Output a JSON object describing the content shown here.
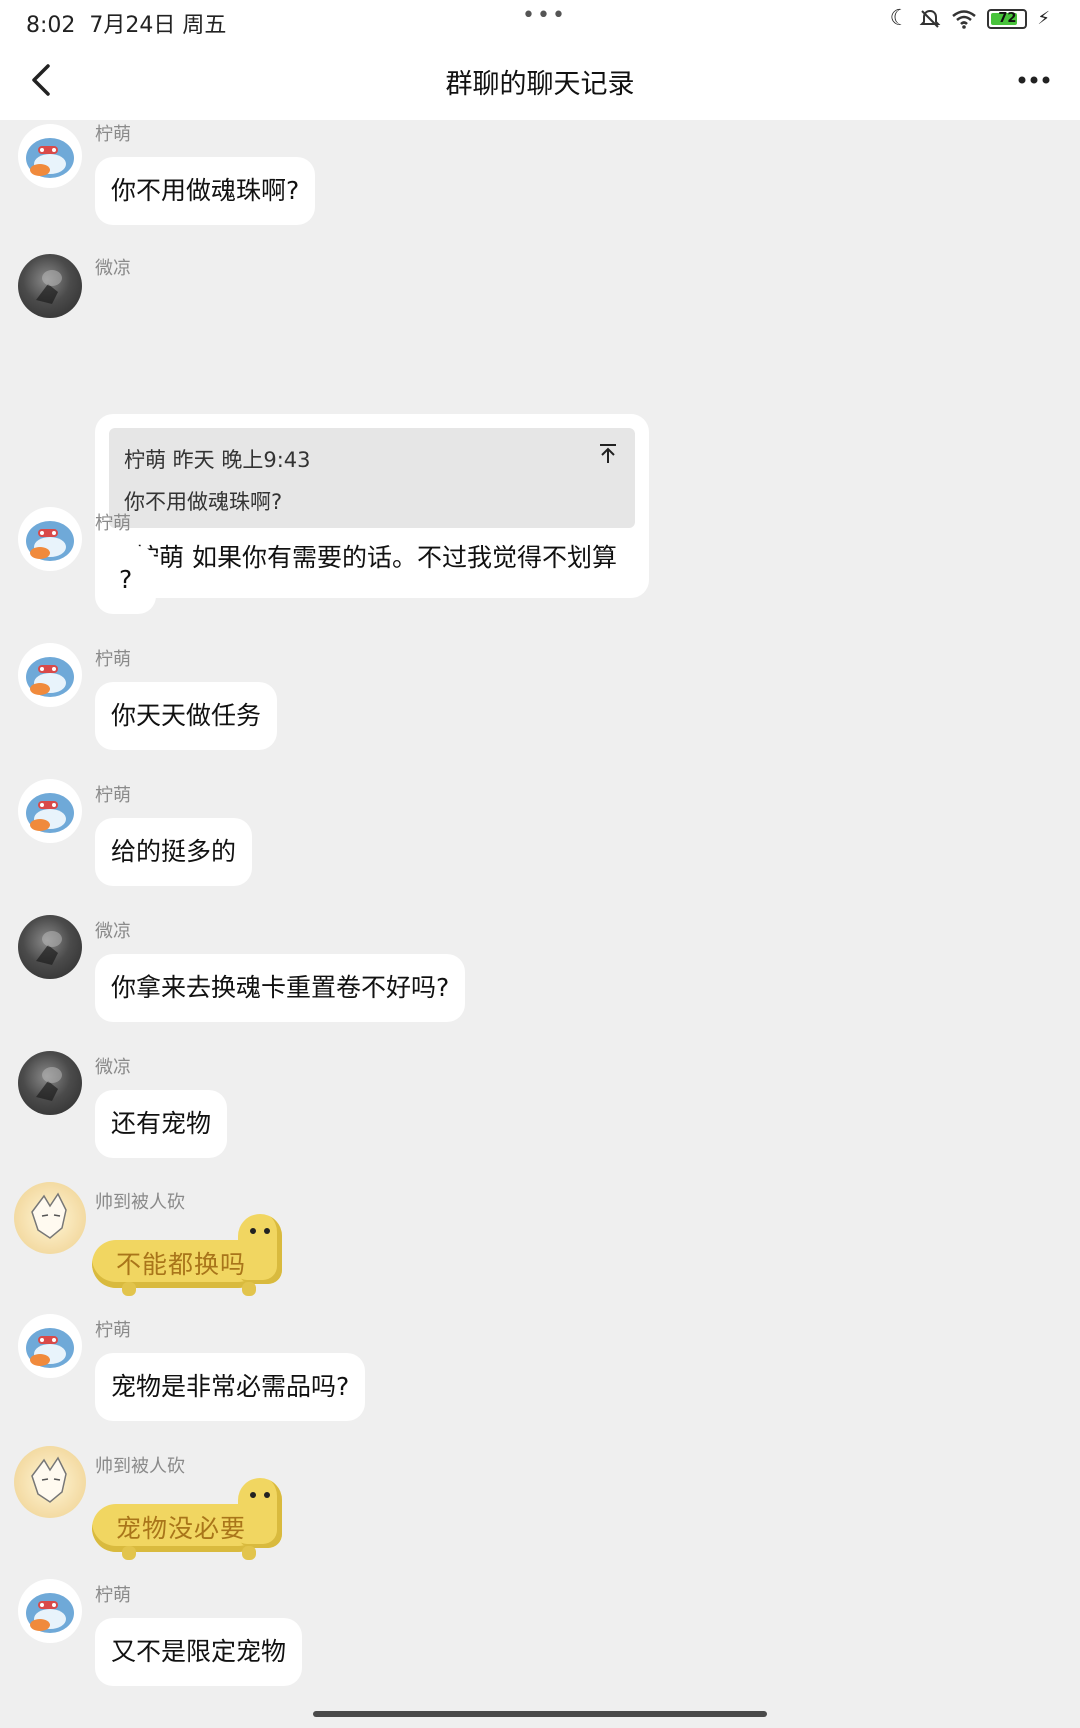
{
  "status": {
    "time": "8:02",
    "date": "7月24日 周五",
    "battery": "72",
    "accent_battery": "#48c33b"
  },
  "header": {
    "title": "群聊的聊天记录",
    "back_icon": "chevron-left-icon",
    "more_icon": "more-dots-icon"
  },
  "messages": [
    {
      "sender": "柠萌",
      "avatar": "whale-avatar",
      "text": "你不用做魂珠啊?"
    },
    {
      "sender": "微凉",
      "avatar": "dark-avatar",
      "quote": {
        "head": "柠萌 昨天 晚上9:43",
        "text": "你不用做魂珠啊?"
      },
      "text": "@柠萌 如果你有需要的话。不过我觉得不划算"
    },
    {
      "sender": "柠萌",
      "avatar": "whale-avatar",
      "text": "?"
    },
    {
      "sender": "柠萌",
      "avatar": "whale-avatar",
      "text": "你天天做任务"
    },
    {
      "sender": "柠萌",
      "avatar": "whale-avatar",
      "text": "给的挺多的"
    },
    {
      "sender": "微凉",
      "avatar": "dark-avatar",
      "text": "你拿来去换魂卡重置卷不好吗?"
    },
    {
      "sender": "微凉",
      "avatar": "dark-avatar",
      "text": "还有宠物"
    },
    {
      "sender": "帅到被人砍",
      "avatar": "anime-avatar",
      "sticker_text": "不能都换吗"
    },
    {
      "sender": "柠萌",
      "avatar": "whale-avatar",
      "text": "宠物是非常必需品吗?"
    },
    {
      "sender": "帅到被人砍",
      "avatar": "anime-avatar",
      "sticker_text": "宠物没必要"
    },
    {
      "sender": "柠萌",
      "avatar": "whale-avatar",
      "text": "又不是限定宠物"
    }
  ]
}
